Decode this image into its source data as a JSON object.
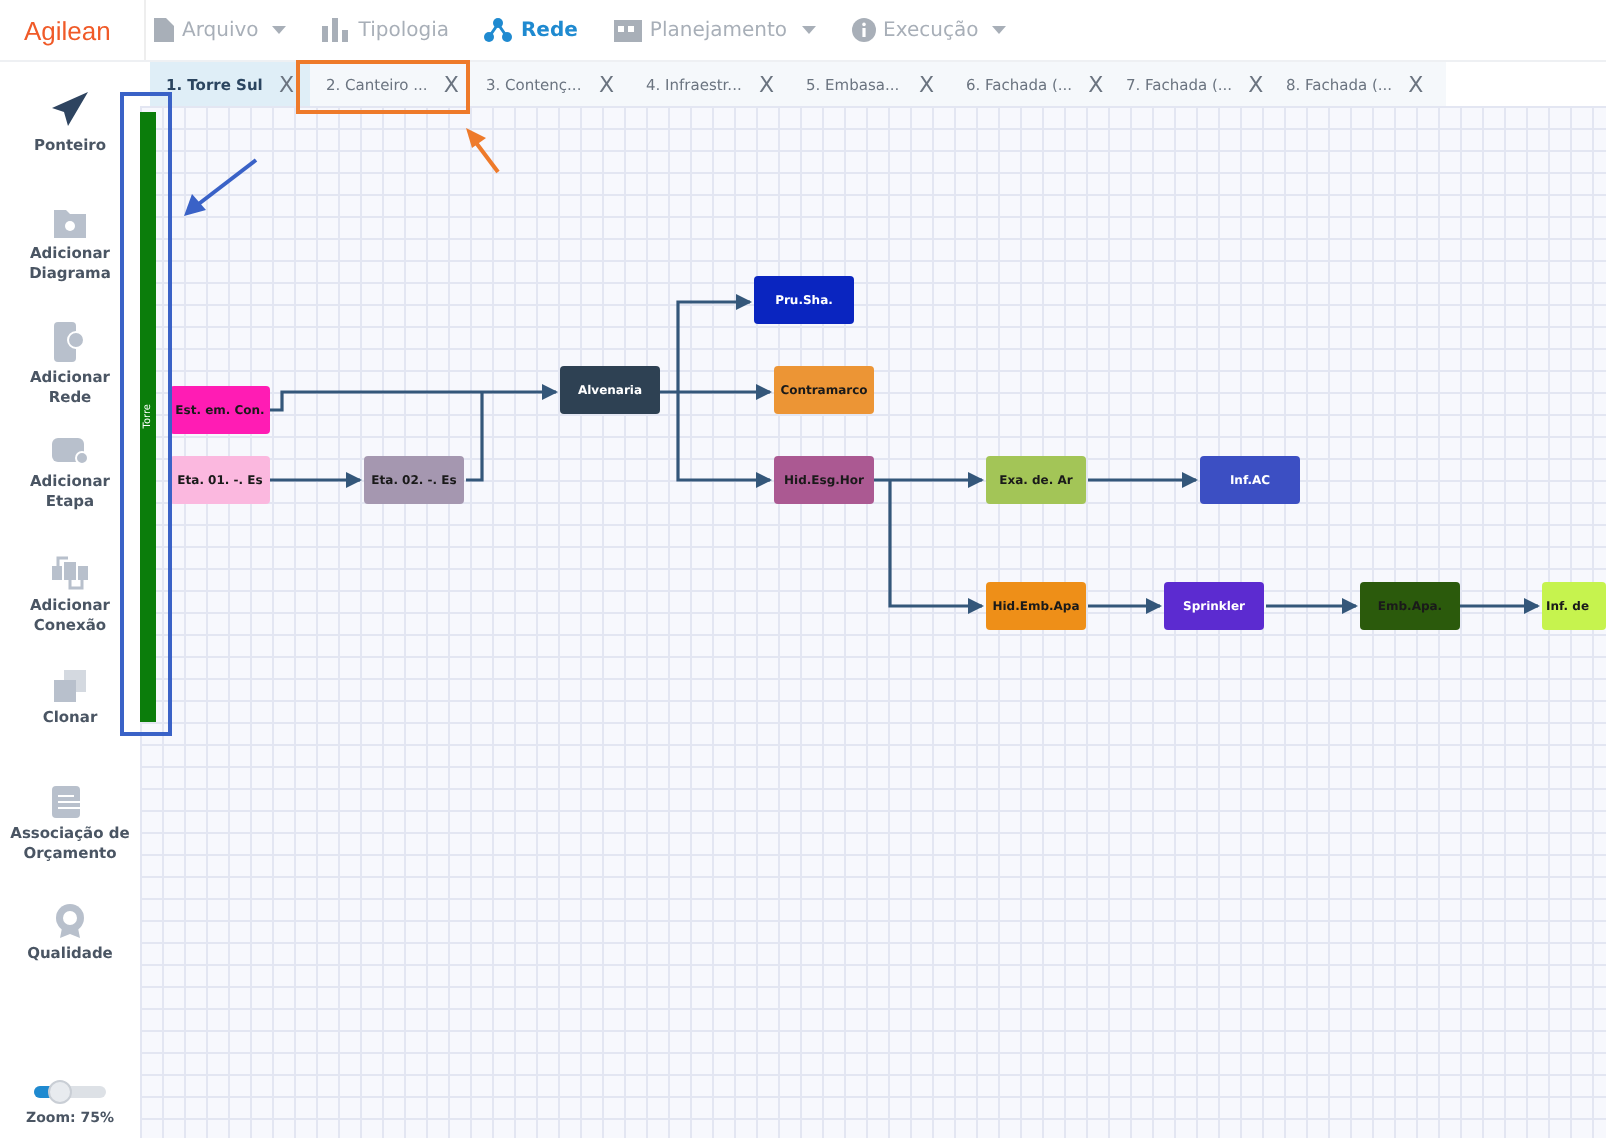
{
  "logo": "Agilean",
  "menu": [
    {
      "label": "Arquivo",
      "dropdown": true,
      "selected": false
    },
    {
      "label": "Tipologia",
      "dropdown": false,
      "selected": false
    },
    {
      "label": "Rede",
      "dropdown": false,
      "selected": true
    },
    {
      "label": "Planejamento",
      "dropdown": true,
      "selected": false
    },
    {
      "label": "Execução",
      "dropdown": true,
      "selected": false
    }
  ],
  "tabs": [
    {
      "label": "1. Torre Sul",
      "close": "X",
      "selected": true
    },
    {
      "label": "2. Canteiro ...",
      "close": "X",
      "selected": false
    },
    {
      "label": "3. Contenç...",
      "close": "X",
      "selected": false
    },
    {
      "label": "4. Infraestr...",
      "close": "X",
      "selected": false
    },
    {
      "label": "5. Embasa...",
      "close": "X",
      "selected": false
    },
    {
      "label": "6. Fachada (...",
      "close": "X",
      "selected": false
    },
    {
      "label": "7. Fachada (...",
      "close": "X",
      "selected": false
    },
    {
      "label": "8. Fachada (...",
      "close": "X",
      "selected": false
    }
  ],
  "tools": [
    {
      "label": "Ponteiro",
      "selected": true
    },
    {
      "label": "Adicionar Diagrama",
      "selected": false
    },
    {
      "label": "Adicionar Rede",
      "selected": false
    },
    {
      "label": "Adicionar Etapa",
      "selected": false
    },
    {
      "label": "Adicionar Conexão",
      "selected": false
    },
    {
      "label": "Clonar",
      "selected": false
    },
    {
      "label": "Associação de Orçamento",
      "selected": false
    },
    {
      "label": "Qualidade",
      "selected": false
    }
  ],
  "zoom": {
    "level": 0.35,
    "label": "Zoom: 75%"
  },
  "lane": {
    "label": "Torre",
    "color": "#0b7d0b"
  },
  "nodes": [
    {
      "label": "Est. em. Con.",
      "color": "#ff1cb4",
      "dark_text": true
    },
    {
      "label": "Eta. 01. -. Es",
      "color": "#fbb8df",
      "dark_text": true
    },
    {
      "label": "Eta. 02. -. Es",
      "color": "#a597b0",
      "dark_text": true
    },
    {
      "label": "Alvenaria",
      "color": "#2e4153",
      "dark_text": false
    },
    {
      "label": "Pru.Sha.",
      "color": "#0a25c0",
      "dark_text": false
    },
    {
      "label": "Contramarco",
      "color": "#ec9535",
      "dark_text": true
    },
    {
      "label": "Hid.Esg.Hor",
      "color": "#ab5992",
      "dark_text": true
    },
    {
      "label": "Exa. de. Ar",
      "color": "#a3c557",
      "dark_text": true
    },
    {
      "label": "Inf.AC",
      "color": "#3c4fc3",
      "dark_text": false
    },
    {
      "label": "Hid.Emb.Apa",
      "color": "#ee8f18",
      "dark_text": true
    },
    {
      "label": "Sprinkler",
      "color": "#5c2bd0",
      "dark_text": false
    },
    {
      "label": "Emb.Apa.",
      "color": "#2b5a0c",
      "dark_text": true
    },
    {
      "label": "Inf. de",
      "color": "#c6f34e",
      "dark_text": true
    }
  ]
}
